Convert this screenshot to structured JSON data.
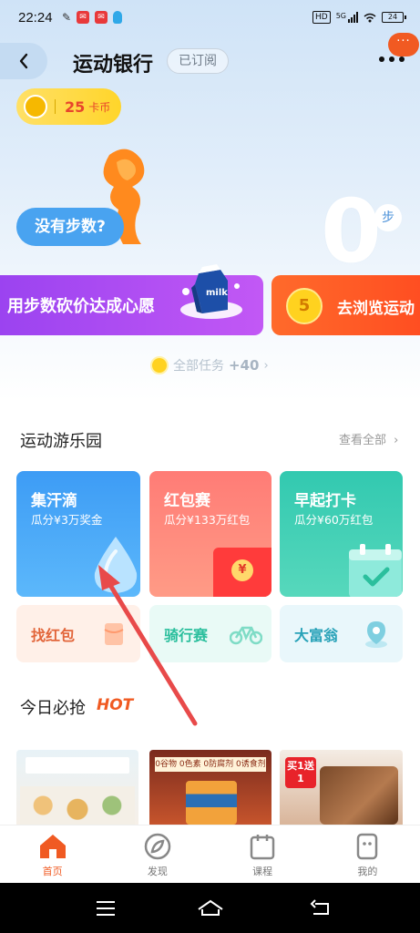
{
  "status_bar": {
    "time": "22:24",
    "network": "5G",
    "hd_label": "HD",
    "battery": "24"
  },
  "header": {
    "title": "运动银行",
    "subscribe_label": "已订阅",
    "notify_badge": "···"
  },
  "coins": {
    "value": "25",
    "unit": "卡币"
  },
  "hero": {
    "no_steps_label": "没有步数?",
    "step_count": "0",
    "step_unit": "步",
    "banner_left_text": "用步数砍价达成心愿",
    "milk_label": "milk",
    "banner_right_coin": "5",
    "banner_right_text": "去浏览运动",
    "all_tasks_label": "全部任务",
    "all_tasks_bonus": "+40"
  },
  "playground": {
    "title": "运动游乐园",
    "see_all": "查看全部",
    "cards": [
      {
        "title": "集汗滴",
        "subtitle": "瓜分¥3万奖金"
      },
      {
        "title": "红包赛",
        "subtitle": "瓜分¥133万红包"
      },
      {
        "title": "早起打卡",
        "subtitle": "瓜分¥60万红包"
      }
    ],
    "small_cards": [
      {
        "label": "找红包"
      },
      {
        "label": "骑行赛"
      },
      {
        "label": "大富翁"
      }
    ],
    "envelope_symbol": "¥"
  },
  "today": {
    "title": "今日必抢",
    "hot": "HOT",
    "product2_tag": "0谷物 0色素 0防腐剂 0诱食剂",
    "product3_tag": "买1送1"
  },
  "tab_bar": {
    "items": [
      {
        "label": "首页"
      },
      {
        "label": "发现"
      },
      {
        "label": "课程"
      },
      {
        "label": "我的"
      }
    ]
  },
  "colors": {
    "accent": "#f05a22",
    "blue": "#3d9cf5",
    "purple": "#9b43f0",
    "teal": "#32c9b0",
    "red_card": "#ff7c76"
  }
}
